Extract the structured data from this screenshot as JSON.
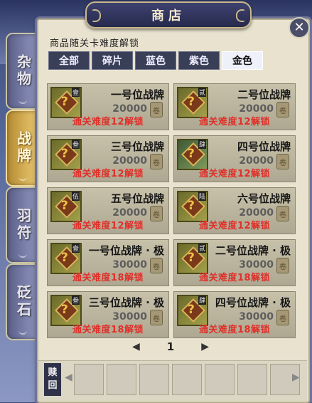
{
  "shop": {
    "title": "商店"
  },
  "side_tabs": [
    {
      "label": "杂物",
      "active": false
    },
    {
      "label": "战牌",
      "active": true
    },
    {
      "label": "羽符",
      "active": false
    },
    {
      "label": "砭石",
      "active": false
    }
  ],
  "notice": "商品随关卡难度解锁",
  "filters": [
    {
      "label": "全部",
      "active": false
    },
    {
      "label": "碎片",
      "active": false
    },
    {
      "label": "蓝色",
      "active": false
    },
    {
      "label": "紫色",
      "active": false
    },
    {
      "label": "金色",
      "active": true
    }
  ],
  "items": [
    {
      "name": "一号位战牌",
      "tag": "壹",
      "price": "20000",
      "lock": "通关难度12解锁"
    },
    {
      "name": "二号位战牌",
      "tag": "贰",
      "price": "20000",
      "lock": "通关难度12解锁"
    },
    {
      "name": "三号位战牌",
      "tag": "叁",
      "price": "20000",
      "lock": "通关难度12解锁"
    },
    {
      "name": "四号位战牌",
      "tag": "肆",
      "price": "20000",
      "lock": "通关难度12解锁"
    },
    {
      "name": "五号位战牌",
      "tag": "伍",
      "price": "20000",
      "lock": "通关难度12解锁"
    },
    {
      "name": "六号位战牌",
      "tag": "陆",
      "price": "20000",
      "lock": "通关难度12解锁"
    },
    {
      "name": "一号位战牌 · 极",
      "tag": "壹",
      "price": "30000",
      "lock": "通关难度18解锁"
    },
    {
      "name": "二号位战牌 · 极",
      "tag": "贰",
      "price": "30000",
      "lock": "通关难度18解锁"
    },
    {
      "name": "三号位战牌 · 极",
      "tag": "叁",
      "price": "30000",
      "lock": "通关难度18解锁"
    },
    {
      "name": "四号位战牌 · 极",
      "tag": "肆",
      "price": "30000",
      "lock": "通关难度18解锁"
    }
  ],
  "pager": {
    "page": "1"
  },
  "redeem": {
    "line1": "赎",
    "line2": "回"
  },
  "icons": {
    "close": "close-icon",
    "prev": "arrow-left-icon",
    "next": "arrow-right-icon",
    "currency": "coin-icon"
  },
  "colors": {
    "lock_text": "#e0302a",
    "active_side_tab": "#d9b35a",
    "panel": "#e8e2cf"
  }
}
